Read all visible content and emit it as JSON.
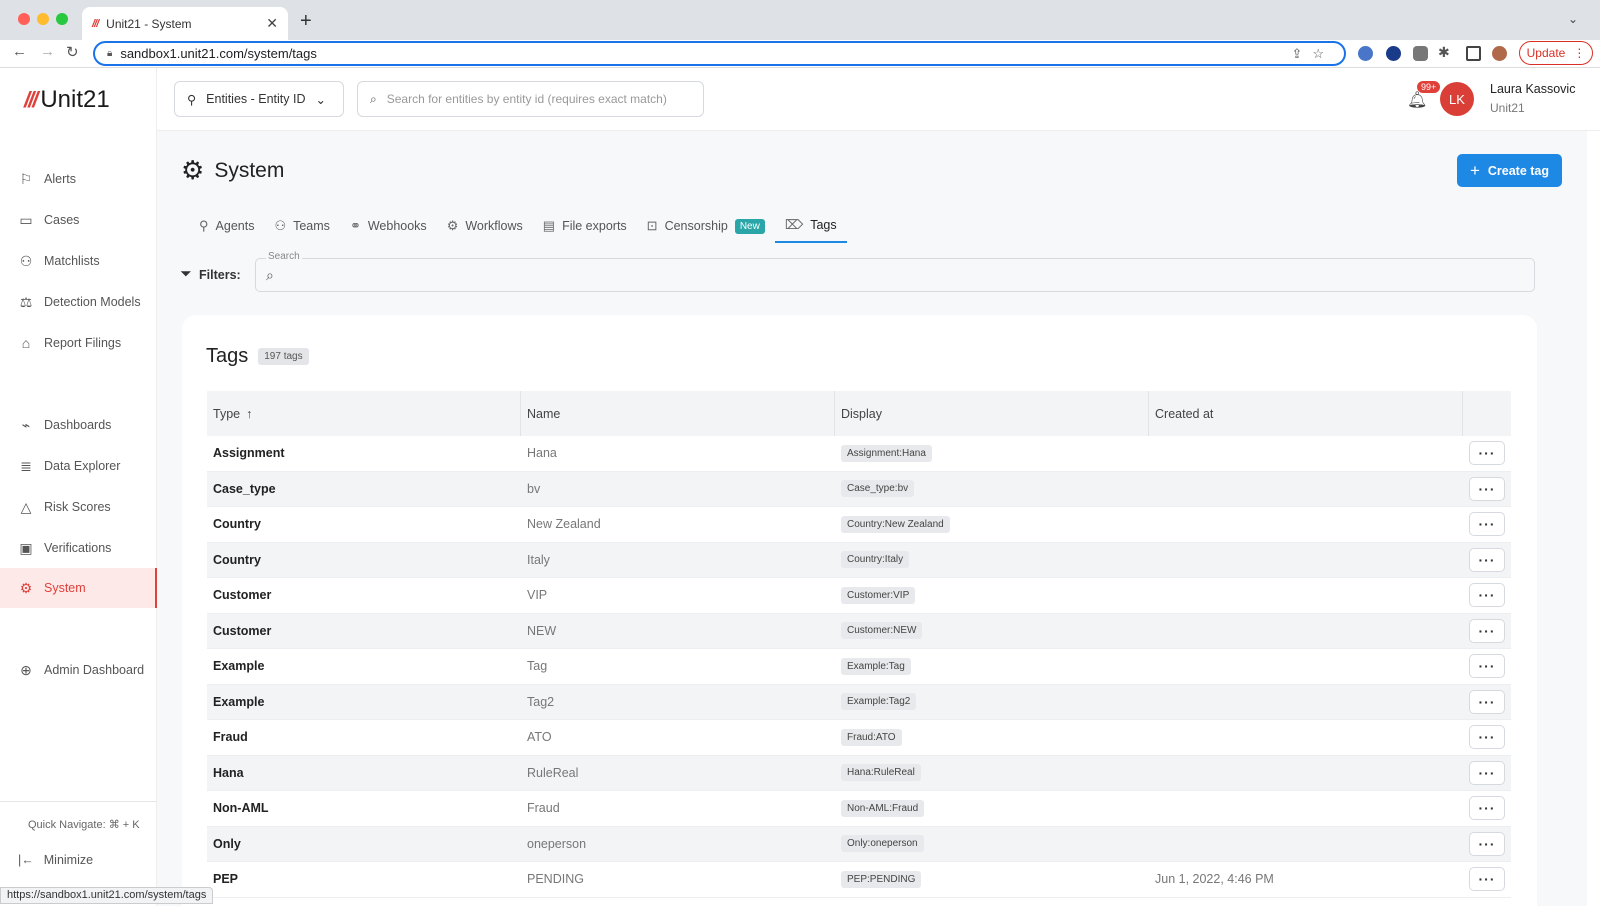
{
  "browser": {
    "tab_title": "Unit21 - System",
    "tab_logo": "///",
    "url": "sandbox1.unit21.com/system/tags",
    "update_label": "Update",
    "status_url": "https://sandbox1.unit21.com/system/tags"
  },
  "brand": {
    "mark": "///",
    "name": "Unit21"
  },
  "sidebar": {
    "items": [
      {
        "label": "Alerts",
        "icon": "flag-icon"
      },
      {
        "label": "Cases",
        "icon": "briefcase-icon"
      },
      {
        "label": "Matchlists",
        "icon": "user-x-icon"
      },
      {
        "label": "Detection Models",
        "icon": "scale-icon"
      },
      {
        "label": "Report Filings",
        "icon": "bank-icon"
      },
      {
        "label": "Dashboards",
        "icon": "chart-icon"
      },
      {
        "label": "Data Explorer",
        "icon": "data-search-icon"
      },
      {
        "label": "Risk Scores",
        "icon": "warning-icon"
      },
      {
        "label": "Verifications",
        "icon": "id-card-icon"
      },
      {
        "label": "System",
        "icon": "gear-icon"
      },
      {
        "label": "Admin Dashboard",
        "icon": "globe-icon"
      }
    ],
    "quick_navigate": "Quick Navigate: ⌘ + K",
    "minimize": "Minimize"
  },
  "topbar": {
    "entity_select": "Entities - Entity ID",
    "search_placeholder": "Search for entities by entity id (requires exact match)",
    "notification_badge": "99+",
    "avatar_initials": "LK",
    "user_name": "Laura Kassovic",
    "user_org": "Unit21"
  },
  "page": {
    "title": "System",
    "create_button": "Create tag",
    "tabs": [
      {
        "label": "Agents",
        "icon": "person-icon"
      },
      {
        "label": "Teams",
        "icon": "people-icon"
      },
      {
        "label": "Webhooks",
        "icon": "link-icon"
      },
      {
        "label": "Workflows",
        "icon": "workflow-icon"
      },
      {
        "label": "File exports",
        "icon": "file-export-icon"
      },
      {
        "label": "Censorship",
        "icon": "censor-icon",
        "badge": "New"
      },
      {
        "label": "Tags",
        "icon": "tag-icon"
      }
    ],
    "filters_label": "Filters:",
    "filter_search_legend": "Search"
  },
  "table": {
    "title": "Tags",
    "count": "197 tags",
    "columns": [
      "Type",
      "Name",
      "Display",
      "Created at"
    ],
    "sort_indicator": "↑",
    "rows": [
      {
        "type": "Assignment",
        "name": "Hana",
        "display": "Assignment:Hana",
        "created": ""
      },
      {
        "type": "Case_type",
        "name": "bv",
        "display": "Case_type:bv",
        "created": ""
      },
      {
        "type": "Country",
        "name": "New Zealand",
        "display": "Country:New Zealand",
        "created": ""
      },
      {
        "type": "Country",
        "name": "Italy",
        "display": "Country:Italy",
        "created": ""
      },
      {
        "type": "Customer",
        "name": "VIP",
        "display": "Customer:VIP",
        "created": ""
      },
      {
        "type": "Customer",
        "name": "NEW",
        "display": "Customer:NEW",
        "created": ""
      },
      {
        "type": "Example",
        "name": "Tag",
        "display": "Example:Tag",
        "created": ""
      },
      {
        "type": "Example",
        "name": "Tag2",
        "display": "Example:Tag2",
        "created": ""
      },
      {
        "type": "Fraud",
        "name": "ATO",
        "display": "Fraud:ATO",
        "created": ""
      },
      {
        "type": "Hana",
        "name": "RuleReal",
        "display": "Hana:RuleReal",
        "created": ""
      },
      {
        "type": "Non-AML",
        "name": "Fraud",
        "display": "Non-AML:Fraud",
        "created": ""
      },
      {
        "type": "Only",
        "name": "oneperson",
        "display": "Only:oneperson",
        "created": ""
      },
      {
        "type": "PEP",
        "name": "PENDING",
        "display": "PEP:PENDING",
        "created": "Jun 1, 2022, 4:46 PM"
      }
    ]
  },
  "colors": {
    "accent": "#1e88e5",
    "brand_red": "#e0403a",
    "badge_teal": "#2aa6a8"
  }
}
